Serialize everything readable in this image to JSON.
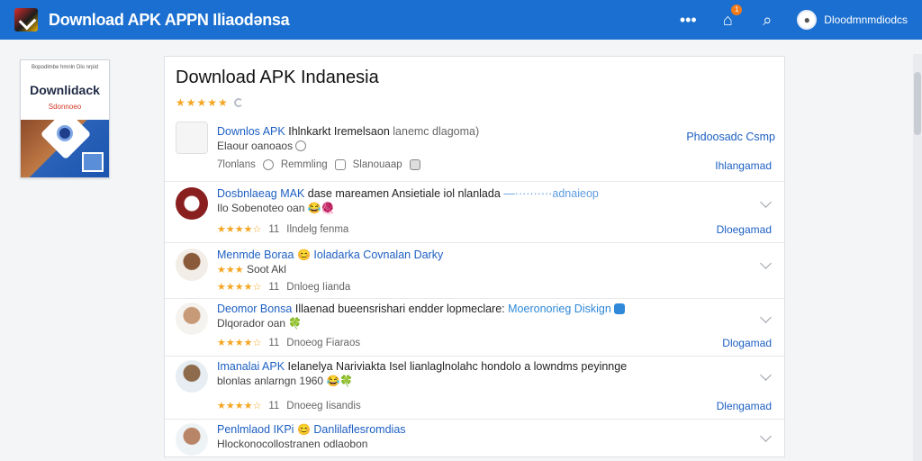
{
  "header": {
    "site_title": "Download APK APPN Iliaodənsa",
    "user_name": "Dloodmnmdiodcs",
    "notification_count": "1",
    "icons": [
      "more-icon",
      "home-icon",
      "search-icon"
    ]
  },
  "cover": {
    "top_text": "Bopodlmbe hmnln Dlo nrpid",
    "title": "Downlidack",
    "subtitle": "Sdonnoeo"
  },
  "main": {
    "title": "Download APK Indanesia",
    "rating_stars": "★★★★★",
    "featured": {
      "title_blue": "Downlos APK",
      "title_dark": "Ihlnkarkt Iremelsaon",
      "title_gray": "lanemc dlagoma)",
      "subtitle": "Elaour oanoaos",
      "publisher": "Phdoosadc Csmp",
      "meta_1": "7lonlans",
      "meta_2": "Remmling",
      "meta_3": "Slanouaap",
      "download_label": "Ihlangamad"
    },
    "items": [
      {
        "title_blue": "Dosbnlaeag MAK",
        "title_dark": "dase mareamen Ansietiale iol nlanlada",
        "title_gray": "—··········adnaieop",
        "subtitle": "Ilo Sobenoteo oan",
        "emoji": "😂🧶",
        "rating_text": "11",
        "meta_text": "Ilndelg fenma",
        "download_label": "Dloegamad"
      },
      {
        "title_blue": "Menmde Boraa",
        "title_dark": "",
        "title_gray": "Ioladarka Covnalan Darky",
        "subtitle": "Soot Akl",
        "emoji": "😊",
        "rating_text": "11",
        "meta_text": "Dnloeg Iianda",
        "download_label": ""
      },
      {
        "title_blue": "Deomor Bonsa",
        "title_dark": "Illaenad bueensrishari endder lopmeclare:",
        "title_gray": "Moeronorieg Diskign",
        "subtitle": "Dlqorador oan",
        "emoji": "🍀",
        "rating_text": "11",
        "meta_text": "Dnoeog Fiaraos",
        "download_label": "Dlogamad"
      },
      {
        "title_blue": "Imanalai APK",
        "title_dark": "Ielanelya Nariviakta Isel lianlaglnolahc hondolo a lowndms peyinnge",
        "title_gray": "",
        "subtitle": "blonlas anlarngn 1960",
        "emoji": "😂🍀",
        "rating_text": "11",
        "meta_text": "Dnoeeg Iisandis",
        "download_label": "Dlengamad"
      },
      {
        "title_blue": "Penlmlaod IKPi",
        "title_dark": "",
        "title_gray": "Danlilaflesromdias",
        "subtitle": "Hlockonocollostranen odlaobon",
        "emoji": "😊",
        "rating_text": "",
        "meta_text": "",
        "download_label": ""
      }
    ]
  },
  "colors": {
    "header_bg": "#1a6fd0",
    "link_blue": "#1d5fc2",
    "star": "#f5a623"
  }
}
